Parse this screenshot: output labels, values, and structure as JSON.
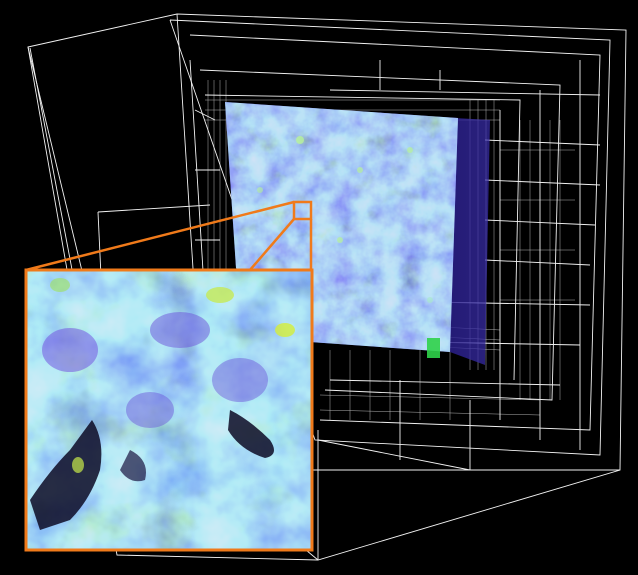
{
  "colors": {
    "background": "#000000",
    "octree_lines": "#ffffff",
    "zoom_frame": "#f07a1a",
    "volume_primary": "#3fb0a8",
    "volume_secondary": "#6a4fd8",
    "volume_highlight": "#8ee07a",
    "volume_dark": "#1a1238"
  }
}
